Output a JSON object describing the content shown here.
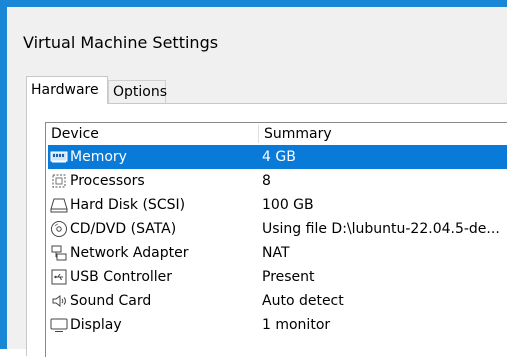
{
  "window": {
    "title": "Virtual Machine Settings"
  },
  "tabs": [
    {
      "label": "Hardware",
      "active": true
    },
    {
      "label": "Options",
      "active": false
    }
  ],
  "device_list": {
    "columns": [
      "Device",
      "Summary"
    ],
    "rows": [
      {
        "device": "Memory",
        "summary": "4 GB",
        "icon": "memory-icon",
        "selected": true
      },
      {
        "device": "Processors",
        "summary": "8",
        "icon": "processor-icon",
        "selected": false
      },
      {
        "device": "Hard Disk (SCSI)",
        "summary": "100 GB",
        "icon": "hard-disk-icon",
        "selected": false
      },
      {
        "device": "CD/DVD (SATA)",
        "summary": "Using file D:\\lubuntu-22.04.5-de...",
        "icon": "cd-dvd-icon",
        "selected": false
      },
      {
        "device": "Network Adapter",
        "summary": "NAT",
        "icon": "network-adapter-icon",
        "selected": false
      },
      {
        "device": "USB Controller",
        "summary": "Present",
        "icon": "usb-controller-icon",
        "selected": false
      },
      {
        "device": "Sound Card",
        "summary": "Auto detect",
        "icon": "sound-card-icon",
        "selected": false
      },
      {
        "device": "Display",
        "summary": "1 monitor",
        "icon": "display-icon",
        "selected": false
      }
    ]
  },
  "colors": {
    "frame": "#1a86d6",
    "selection": "#0a7ad8"
  }
}
